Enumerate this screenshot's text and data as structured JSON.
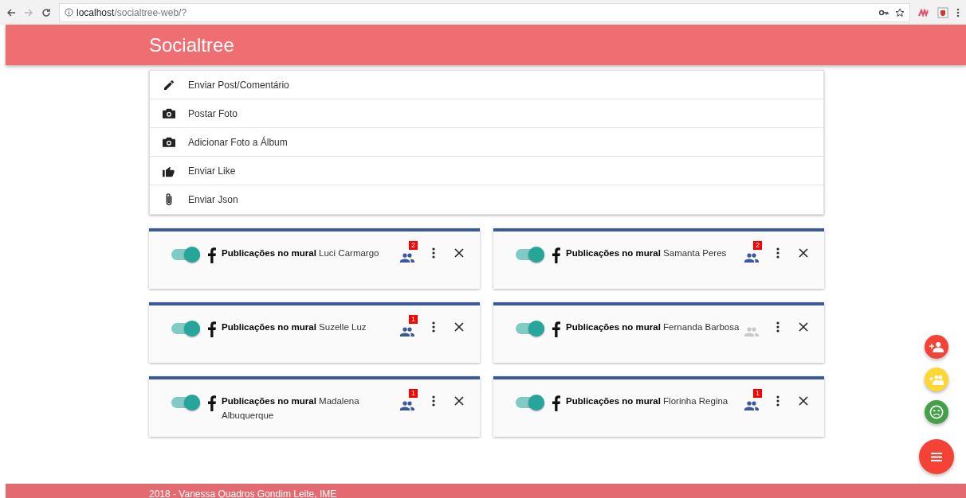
{
  "browser": {
    "url_host": "localhost",
    "url_path": "/socialtree-web/?"
  },
  "app_bar": {
    "title": "Socialtree"
  },
  "actions": [
    {
      "kind": "pencil",
      "label": "Enviar Post/Comentário"
    },
    {
      "kind": "camera",
      "label": "Postar Foto"
    },
    {
      "kind": "camera",
      "label": "Adicionar Foto a Álbum"
    },
    {
      "kind": "like",
      "label": "Enviar Like"
    },
    {
      "kind": "clip",
      "label": "Enviar Json"
    }
  ],
  "feeds": [
    [
      {
        "on": true,
        "title": "Publicações no mural",
        "name": "Luci Carmargo",
        "friends_active": true,
        "badge": "2"
      },
      {
        "on": true,
        "title": "Publicações no mural",
        "name": "Samanta Peres",
        "friends_active": true,
        "badge": "2"
      }
    ],
    [
      {
        "on": true,
        "title": "Publicações no mural",
        "name": "Suzelle Luz",
        "friends_active": true,
        "badge": "1"
      },
      {
        "on": true,
        "title": "Publicações no mural",
        "name": "Fernanda Barbosa",
        "friends_active": false
      }
    ],
    [
      {
        "on": true,
        "title": "Publicações no mural",
        "name": "Madalena Albuquerque",
        "friends_active": true,
        "badge": "1"
      },
      {
        "on": true,
        "title": "Publicações no mural",
        "name": "Florinha Regina",
        "friends_active": true,
        "badge": "1"
      }
    ]
  ],
  "fabs": [
    {
      "kind": "add-person",
      "color": "#f44336"
    },
    {
      "kind": "add-group",
      "color": "#fdd835"
    },
    {
      "kind": "sad",
      "color": "#43a047"
    },
    {
      "kind": "menu",
      "color": "#f44336"
    }
  ],
  "footer": {
    "text": "2018 - Vanessa Quadros Gondim Leite, IME"
  }
}
